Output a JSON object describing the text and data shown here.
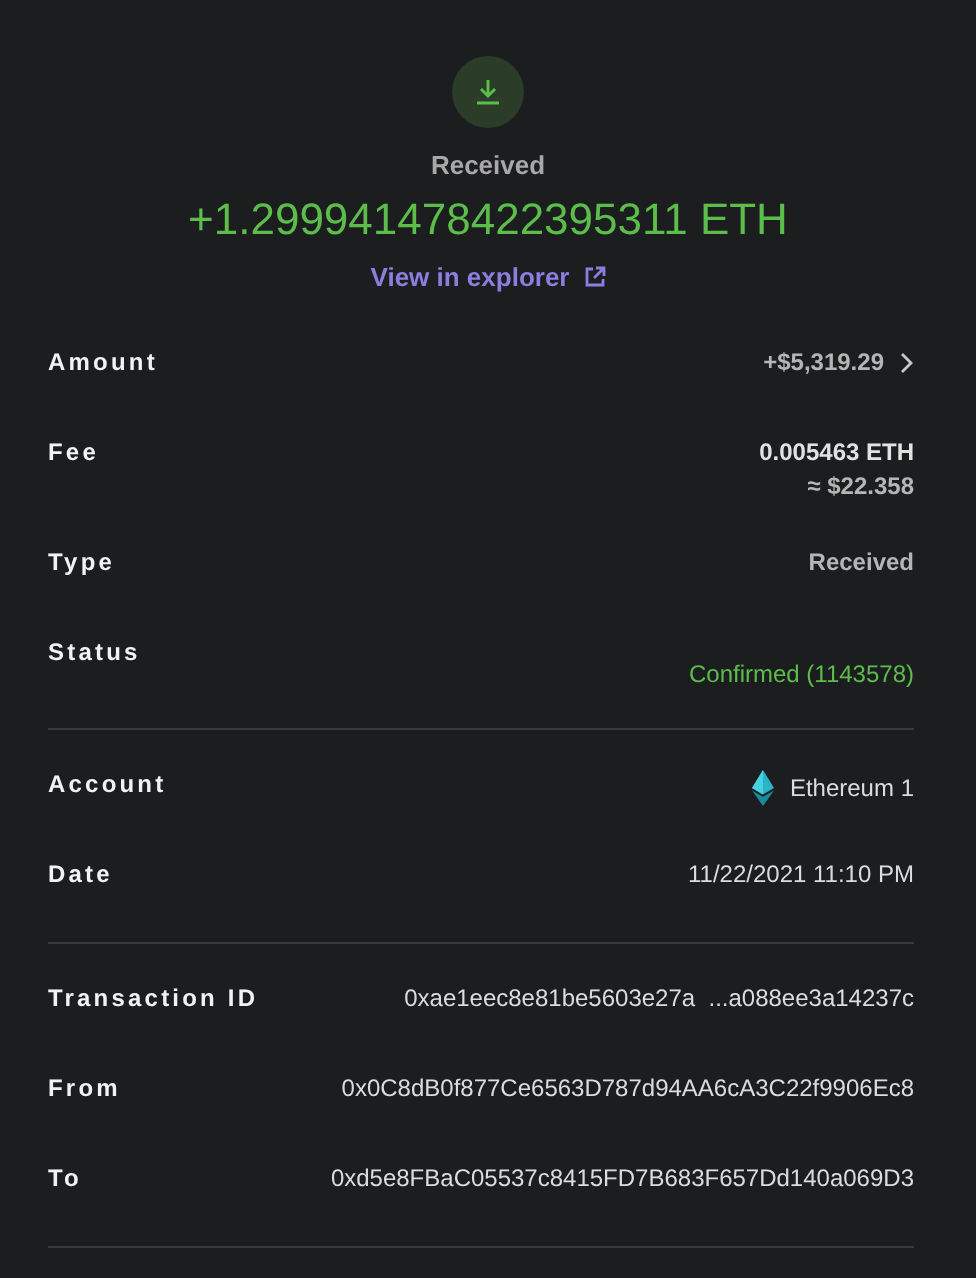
{
  "header": {
    "status": "Received",
    "amount": "+1.299941478422395311 ETH",
    "explorer_link": "View in explorer"
  },
  "sections": [
    [
      {
        "kind": "chevron",
        "label": "Amount",
        "values": [
          "+$5,319.29"
        ]
      },
      {
        "kind": "text",
        "label": "Fee",
        "values": [
          "0.005463 ETH",
          "≈ $22.358"
        ]
      },
      {
        "kind": "text",
        "label": "Type",
        "values": [
          "Received"
        ]
      },
      {
        "kind": "status",
        "label": "Status",
        "values": [
          "Confirmed (1143578)"
        ]
      }
    ],
    [
      {
        "kind": "account",
        "label": "Account",
        "values": [
          "Ethereum 1"
        ]
      },
      {
        "kind": "plain",
        "label": "Date",
        "values": [
          "11/22/2021 11:10 PM"
        ]
      }
    ],
    [
      {
        "kind": "plain",
        "label": "Transaction ID",
        "values": [
          "0xae1eec8e81be5603e27a  ...a088ee3a14237c"
        ]
      },
      {
        "kind": "plain",
        "label": "From",
        "values": [
          "0x0C8dB0f877Ce6563D787d94AA6cA3C22f9906Ec8"
        ]
      },
      {
        "kind": "plain",
        "label": "To",
        "values": [
          "0xd5e8FBaC05537c8415FD7B683F657Dd140a069D3"
        ]
      }
    ]
  ]
}
